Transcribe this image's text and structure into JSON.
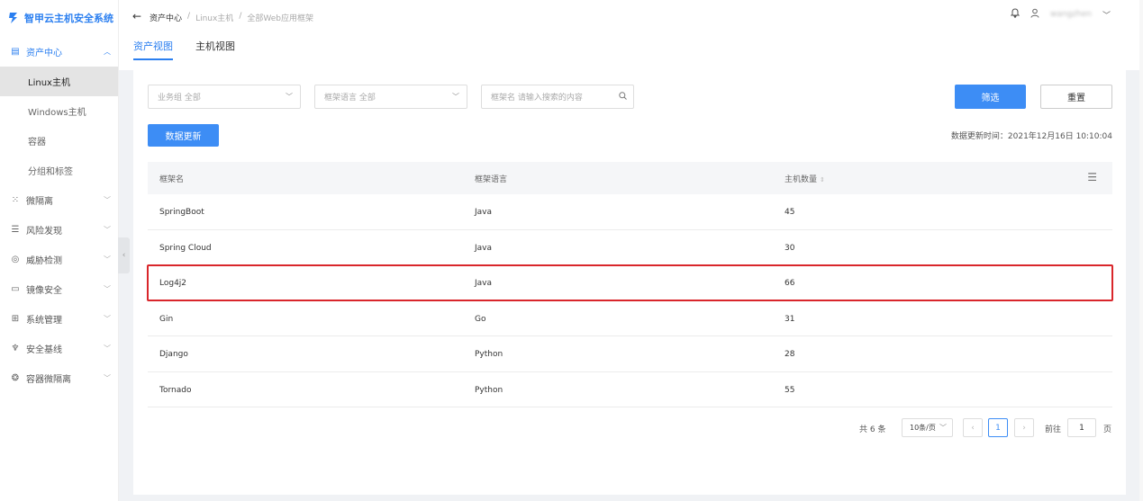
{
  "app": {
    "title": "智甲云主机安全系统"
  },
  "sidebar": {
    "parent": {
      "label": "资产中心"
    },
    "sub_items": [
      {
        "label": "Linux主机"
      },
      {
        "label": "Windows主机"
      },
      {
        "label": "容器"
      },
      {
        "label": "分组和标签"
      }
    ],
    "items": [
      {
        "label": "微隔离",
        "icon": "grid-icon"
      },
      {
        "label": "风险发现",
        "icon": "search-list-icon"
      },
      {
        "label": "威胁检测",
        "icon": "radar-icon"
      },
      {
        "label": "镜像安全",
        "icon": "image-icon"
      },
      {
        "label": "系统管理",
        "icon": "apps-icon"
      },
      {
        "label": "安全基线",
        "icon": "baseline-icon"
      },
      {
        "label": "容器微隔离",
        "icon": "network-icon"
      }
    ]
  },
  "header": {
    "breadcrumb": [
      "资产中心",
      "/",
      "Linux主机",
      "/",
      "全部Web应用框架"
    ],
    "username": "wangzhen"
  },
  "tabs": [
    {
      "label": "资产视图"
    },
    {
      "label": "主机视图"
    }
  ],
  "filters": {
    "group_placeholder": "业务组 全部",
    "language_placeholder": "框架语言 全部",
    "search_placeholder": "框架名 请输入搜索的内容",
    "filter_button": "筛选",
    "reset_button": "重置",
    "update_button": "数据更新",
    "update_time": "数据更新时间：2021年12月16日 10:10:04"
  },
  "table": {
    "columns": [
      "框架名",
      "框架语言",
      "主机数量"
    ],
    "rows": [
      {
        "name": "SpringBoot",
        "language": "Java",
        "hosts": "45"
      },
      {
        "name": "Spring Cloud",
        "language": "Java",
        "hosts": "30"
      },
      {
        "name": "Log4j2",
        "language": "Java",
        "hosts": "66"
      },
      {
        "name": "Gin",
        "language": "Go",
        "hosts": "31"
      },
      {
        "name": "Django",
        "language": "Python",
        "hosts": "28"
      },
      {
        "name": "Tornado",
        "language": "Python",
        "hosts": "55"
      }
    ],
    "highlighted_row": "Log4j2"
  },
  "pagination": {
    "total": "共 6 条",
    "page_size": "10条/页",
    "current_page": "1",
    "goto_label": "前往",
    "goto_value": "1",
    "goto_unit": "页"
  },
  "colors": {
    "primary": "#3d8df5",
    "highlight_border": "#d9262b"
  }
}
